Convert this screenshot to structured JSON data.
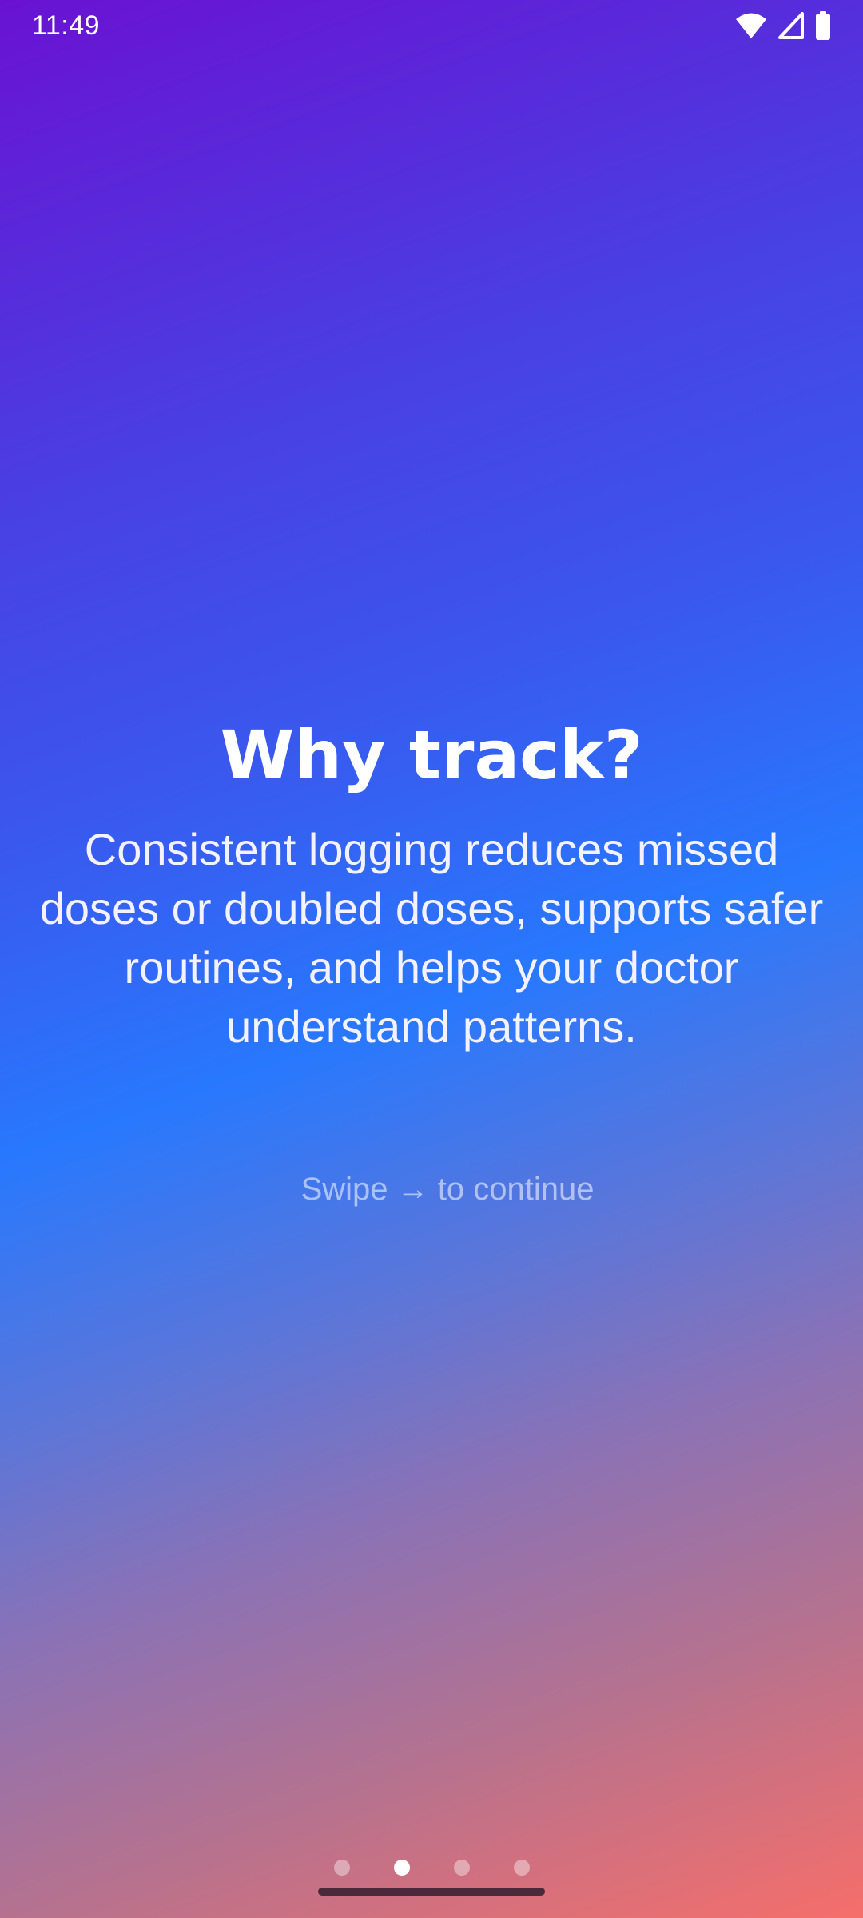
{
  "status_bar": {
    "time": "11:49",
    "icons": [
      "wifi-icon",
      "cellular-signal-icon",
      "battery-icon"
    ]
  },
  "onboarding": {
    "title": "Why track?",
    "body": "Consistent logging reduces missed doses or doubled doses, supports safer routines, and helps your doctor understand patterns.",
    "hint": "Swipe → to continue"
  },
  "pager": {
    "total_pages": 4,
    "current_page": 2
  },
  "colors": {
    "gradient_top": "#6a12d2",
    "gradient_mid": "#2878fe",
    "gradient_bottom": "#f66e6a",
    "text": "#ffffff"
  }
}
